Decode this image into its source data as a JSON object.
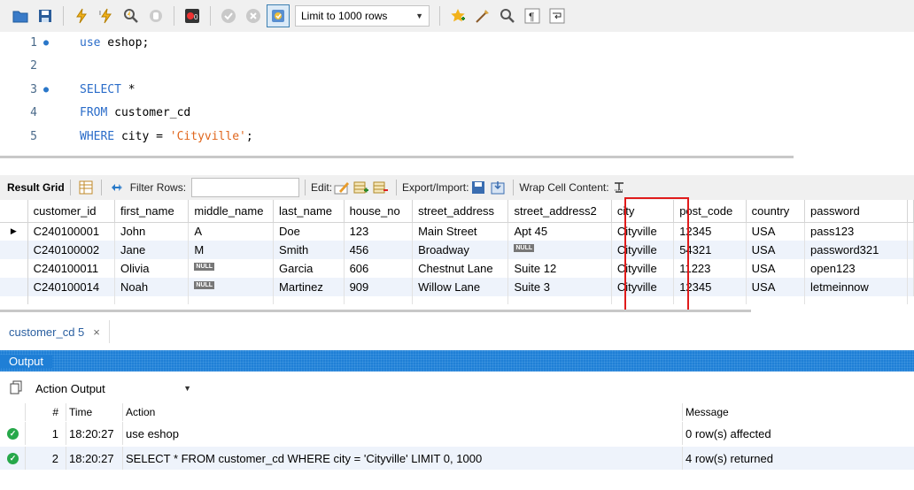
{
  "toolbar": {
    "limit_select": "Limit to 1000 rows",
    "icons": [
      "folder-open-icon",
      "save-icon",
      "execute-icon",
      "execute-current-icon",
      "explain-icon",
      "stop-icon",
      "toggle-error-icon",
      "commit-icon",
      "rollback-icon",
      "autocommit-icon",
      "add-snippet-icon",
      "beautify-icon",
      "find-icon",
      "invisible-chars-icon",
      "wrap-icon"
    ]
  },
  "editor": {
    "lines": [
      {
        "num": "1",
        "dot": true,
        "parts": [
          {
            "t": "use",
            "c": "kw"
          },
          {
            "t": " eshop;",
            "c": ""
          }
        ]
      },
      {
        "num": "2",
        "dot": false,
        "parts": []
      },
      {
        "num": "3",
        "dot": true,
        "parts": [
          {
            "t": "SELECT",
            "c": "kw"
          },
          {
            "t": " *",
            "c": ""
          }
        ]
      },
      {
        "num": "4",
        "dot": false,
        "parts": [
          {
            "t": "FROM",
            "c": "kw"
          },
          {
            "t": " customer_cd",
            "c": ""
          }
        ]
      },
      {
        "num": "5",
        "dot": false,
        "parts": [
          {
            "t": "WHERE",
            "c": "kw"
          },
          {
            "t": " city = ",
            "c": ""
          },
          {
            "t": "'Cityville'",
            "c": "str"
          },
          {
            "t": ";",
            "c": ""
          }
        ]
      }
    ]
  },
  "result_bar": {
    "result_grid": "Result Grid",
    "filter_rows": "Filter Rows:",
    "filter_value": "",
    "edit": "Edit:",
    "export_import": "Export/Import:",
    "wrap_cell": "Wrap Cell Content:"
  },
  "grid": {
    "columns": [
      "customer_id",
      "first_name",
      "middle_name",
      "last_name",
      "house_no",
      "street_address",
      "street_address2",
      "city",
      "post_code",
      "country",
      "password"
    ],
    "rows": [
      [
        "C240100001",
        "John",
        "A",
        "Doe",
        "123",
        "Main Street",
        "Apt 45",
        "Cityville",
        "12345",
        "USA",
        "pass123"
      ],
      [
        "C240100002",
        "Jane",
        "M",
        "Smith",
        "456",
        "Broadway",
        "NULL",
        "Cityville",
        "54321",
        "USA",
        "password321"
      ],
      [
        "C240100011",
        "Olivia",
        "NULL",
        "Garcia",
        "606",
        "Chestnut Lane",
        "Suite 12",
        "Cityville",
        "11223",
        "USA",
        "open123"
      ],
      [
        "C240100014",
        "Noah",
        "NULL",
        "Martinez",
        "909",
        "Willow Lane",
        "Suite 3",
        "Cityville",
        "12345",
        "USA",
        "letmeinnow"
      ]
    ]
  },
  "tab": {
    "label": "customer_cd 5",
    "close": "×"
  },
  "output": {
    "title": "Output",
    "action_select": "Action Output",
    "headers": {
      "num": "#",
      "time": "Time",
      "action": "Action",
      "message": "Message"
    },
    "rows": [
      {
        "num": "1",
        "time": "18:20:27",
        "action": "use eshop",
        "message": "0 row(s) affected"
      },
      {
        "num": "2",
        "time": "18:20:27",
        "action": "SELECT * FROM customer_cd WHERE city = 'Cityville' LIMIT 0, 1000",
        "message": "4 row(s) returned"
      }
    ]
  },
  "colors": {
    "accent": "#1f7fd6",
    "keyword": "#2a6cc9",
    "string": "#e0661c",
    "highlight": "#e01b1b",
    "success": "#27a84a"
  }
}
